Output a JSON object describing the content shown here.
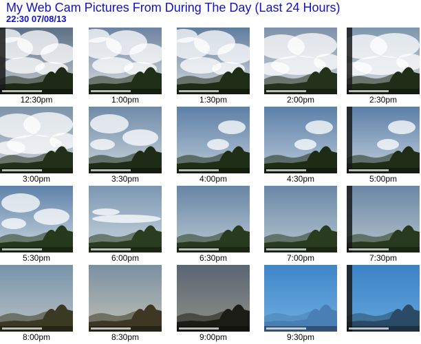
{
  "header": {
    "title": "My Web Cam Pictures From During The Day (Last 24 Hours)",
    "timestamp": "22:30  07/08/13"
  },
  "colors": {
    "title": "#1010cc"
  },
  "thumbnails": [
    {
      "time": "12:30pm",
      "sky_top": "#5b6f86",
      "sky_bottom": "#c7ccd1",
      "clouds": "heavy",
      "ground": "#1f2a16",
      "frame": true
    },
    {
      "time": "1:00pm",
      "sky_top": "#6c83a0",
      "sky_bottom": "#d9dcdf",
      "clouds": "heavy",
      "ground": "#203018",
      "frame": false
    },
    {
      "time": "1:30pm",
      "sky_top": "#5f7c9e",
      "sky_bottom": "#d6dbe0",
      "clouds": "heavy",
      "ground": "#1f2c16",
      "frame": false
    },
    {
      "time": "2:00pm",
      "sky_top": "#7e92aa",
      "sky_bottom": "#cfd5da",
      "clouds": "overcast",
      "ground": "#24321b",
      "frame": false
    },
    {
      "time": "2:30pm",
      "sky_top": "#7f96b0",
      "sky_bottom": "#d3d8dc",
      "clouds": "overcast",
      "ground": "#202e18",
      "frame": true
    },
    {
      "time": "3:00pm",
      "sky_top": "#7d93aa",
      "sky_bottom": "#ccd3d9",
      "clouds": "overcast",
      "ground": "#22301a",
      "frame": false
    },
    {
      "time": "3:30pm",
      "sky_top": "#6f8aa8",
      "sky_bottom": "#c9d3dc",
      "clouds": "medium",
      "ground": "#1e2b16",
      "frame": false
    },
    {
      "time": "4:00pm",
      "sky_top": "#5d7fa6",
      "sky_bottom": "#b9c9d8",
      "clouds": "light",
      "ground": "#1f2e17",
      "frame": false
    },
    {
      "time": "4:30pm",
      "sky_top": "#5c80a9",
      "sky_bottom": "#b7c8d8",
      "clouds": "light",
      "ground": "#1e2c16",
      "frame": false
    },
    {
      "time": "5:00pm",
      "sky_top": "#5b7fa8",
      "sky_bottom": "#c0cedb",
      "clouds": "light",
      "ground": "#1f2d17",
      "frame": true
    },
    {
      "time": "5:30pm",
      "sky_top": "#5e82aa",
      "sky_bottom": "#cbd6df",
      "clouds": "medium",
      "ground": "#253a1c",
      "frame": false
    },
    {
      "time": "6:00pm",
      "sky_top": "#7b97b4",
      "sky_bottom": "#c9d4dc",
      "clouds": "band",
      "ground": "#2a3d20",
      "frame": false
    },
    {
      "time": "6:30pm",
      "sky_top": "#6785a6",
      "sky_bottom": "#b9c8d4",
      "clouds": "clear",
      "ground": "#283b1e",
      "frame": false
    },
    {
      "time": "7:00pm",
      "sky_top": "#6988a8",
      "sky_bottom": "#b5c4cf",
      "clouds": "clear",
      "ground": "#293c1f",
      "frame": false
    },
    {
      "time": "7:30pm",
      "sky_top": "#6a87a6",
      "sky_bottom": "#b4c2cc",
      "clouds": "clear",
      "ground": "#283a1e",
      "frame": true
    },
    {
      "time": "8:00pm",
      "sky_top": "#7893ab",
      "sky_bottom": "#b7c0c4",
      "clouds": "clear",
      "ground": "#3a3a22",
      "frame": false
    },
    {
      "time": "8:30pm",
      "sky_top": "#7a90a4",
      "sky_bottom": "#bfbfb3",
      "clouds": "clear",
      "ground": "#3d3724",
      "frame": false
    },
    {
      "time": "9:00pm",
      "sky_top": "#5a6674",
      "sky_bottom": "#8e8e86",
      "clouds": "clear",
      "ground": "#1c1c16",
      "frame": false
    },
    {
      "time": "9:30pm",
      "sky_top": "#3f86c9",
      "sky_bottom": "#6eaee0",
      "clouds": "none",
      "ground": "#4a7fb5",
      "frame": false
    },
    {
      "time": "",
      "sky_top": "#3b82c6",
      "sky_bottom": "#63a6dc",
      "clouds": "none",
      "ground": "#2a4a66",
      "frame": true
    }
  ]
}
